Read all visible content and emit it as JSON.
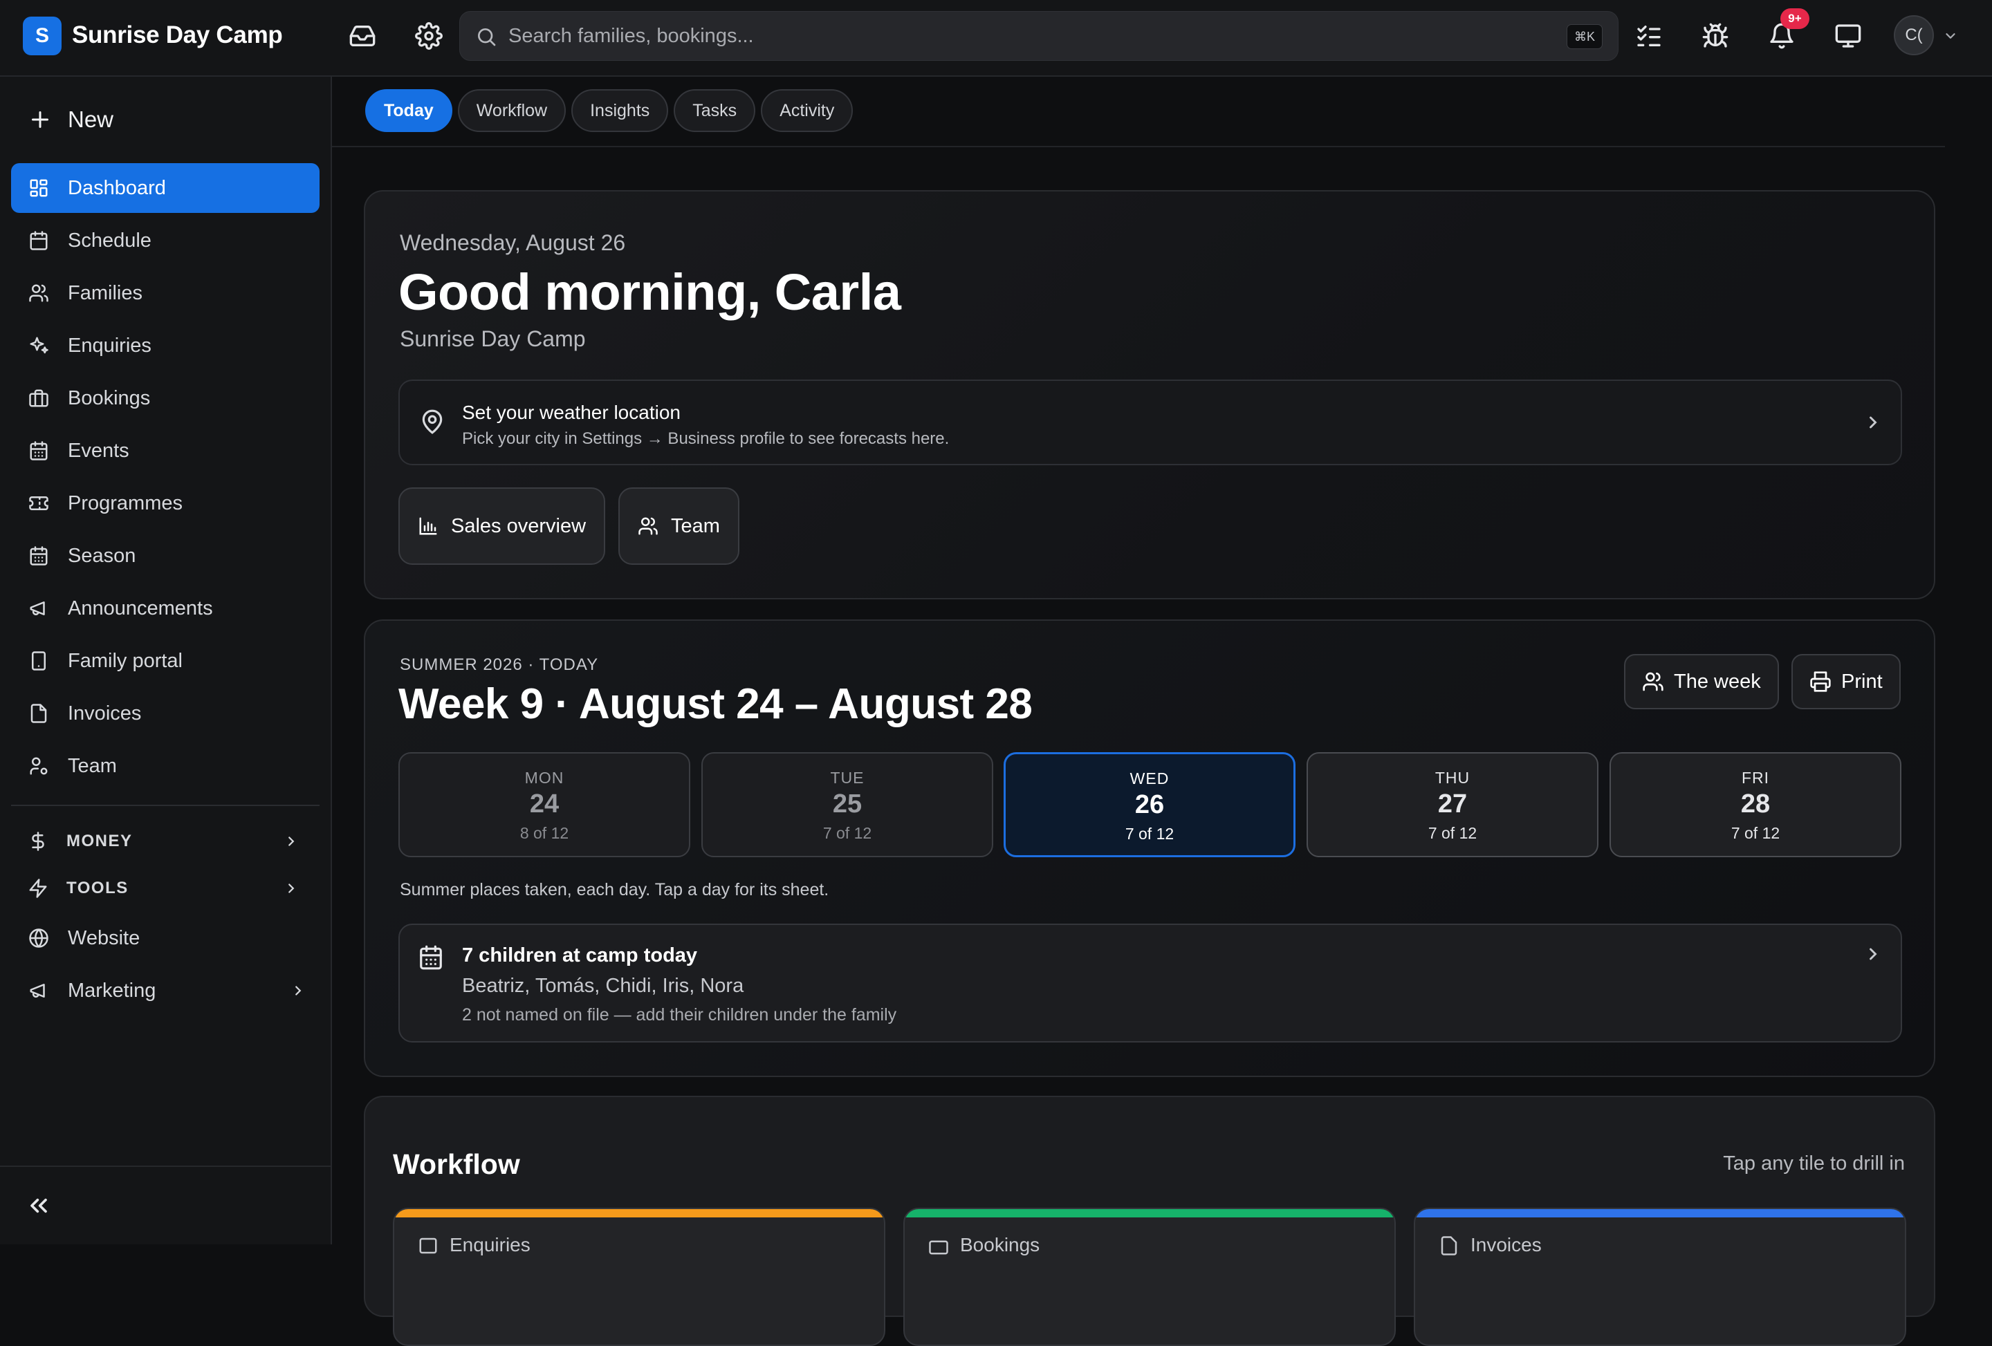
{
  "app": {
    "logo_letter": "S",
    "name": "Sunrise Day Camp"
  },
  "search": {
    "placeholder": "Search families, bookings...",
    "shortcut": "⌘K"
  },
  "notifications": {
    "badge": "9+"
  },
  "user": {
    "initials": "C("
  },
  "sidebar": {
    "new_label": "New",
    "items": [
      {
        "label": "Dashboard",
        "icon": "dashboard-icon",
        "active": true
      },
      {
        "label": "Schedule",
        "icon": "calendar-icon"
      },
      {
        "label": "Families",
        "icon": "users-icon"
      },
      {
        "label": "Enquiries",
        "icon": "sparkles-icon"
      },
      {
        "label": "Bookings",
        "icon": "briefcase-icon"
      },
      {
        "label": "Events",
        "icon": "calendar-grid-icon"
      },
      {
        "label": "Programmes",
        "icon": "ticket-icon"
      },
      {
        "label": "Season",
        "icon": "calendar-grid-icon"
      },
      {
        "label": "Announcements",
        "icon": "megaphone-icon"
      },
      {
        "label": "Family portal",
        "icon": "phone-icon"
      },
      {
        "label": "Invoices",
        "icon": "file-icon"
      },
      {
        "label": "Team",
        "icon": "user-cog-icon"
      }
    ],
    "sections": [
      {
        "label": "MONEY",
        "icon": "dollar-icon"
      },
      {
        "label": "TOOLS",
        "icon": "bolt-icon"
      }
    ],
    "extra": [
      {
        "label": "Website",
        "icon": "globe-icon"
      },
      {
        "label": "Marketing",
        "icon": "megaphone-icon"
      }
    ]
  },
  "tabs": [
    {
      "label": "Today",
      "active": true
    },
    {
      "label": "Workflow"
    },
    {
      "label": "Insights"
    },
    {
      "label": "Tasks"
    },
    {
      "label": "Activity"
    }
  ],
  "greeting": {
    "date": "Wednesday, August 26",
    "title": "Good morning, Carla",
    "business": "Sunrise Day Camp",
    "weather_title": "Set your weather location",
    "weather_sub": "Pick your city in Settings → Business profile to see forecasts here.",
    "btn_sales": "Sales overview",
    "btn_team": "Team"
  },
  "week": {
    "season": "SUMMER 2026 · TODAY",
    "title": "Week 9 · August 24 – August 28",
    "btn_week": "The week",
    "btn_print": "Print",
    "days": [
      {
        "name": "MON",
        "num": "24",
        "cap": "8 of 12"
      },
      {
        "name": "TUE",
        "num": "25",
        "cap": "7 of 12"
      },
      {
        "name": "WED",
        "num": "26",
        "cap": "7 of 12"
      },
      {
        "name": "THU",
        "num": "27",
        "cap": "7 of 12"
      },
      {
        "name": "FRI",
        "num": "28",
        "cap": "7 of 12"
      }
    ],
    "note": "Summer places taken, each day. Tap a day for its sheet.",
    "camp_title": "7 children at camp today",
    "camp_names": "Beatriz, Tomás, Chidi, Iris, Nora",
    "camp_note": "2 not named on file — add their children under the family"
  },
  "workflow": {
    "title": "Workflow",
    "hint": "Tap any tile to drill in",
    "tiles": [
      {
        "label": "Enquiries",
        "color": "#f59a1b"
      },
      {
        "label": "Bookings",
        "color": "#16b26a"
      },
      {
        "label": "Invoices",
        "color": "#2f73ea"
      }
    ]
  },
  "colors": {
    "accent": "#1670e3",
    "badge": "#e5284a"
  }
}
